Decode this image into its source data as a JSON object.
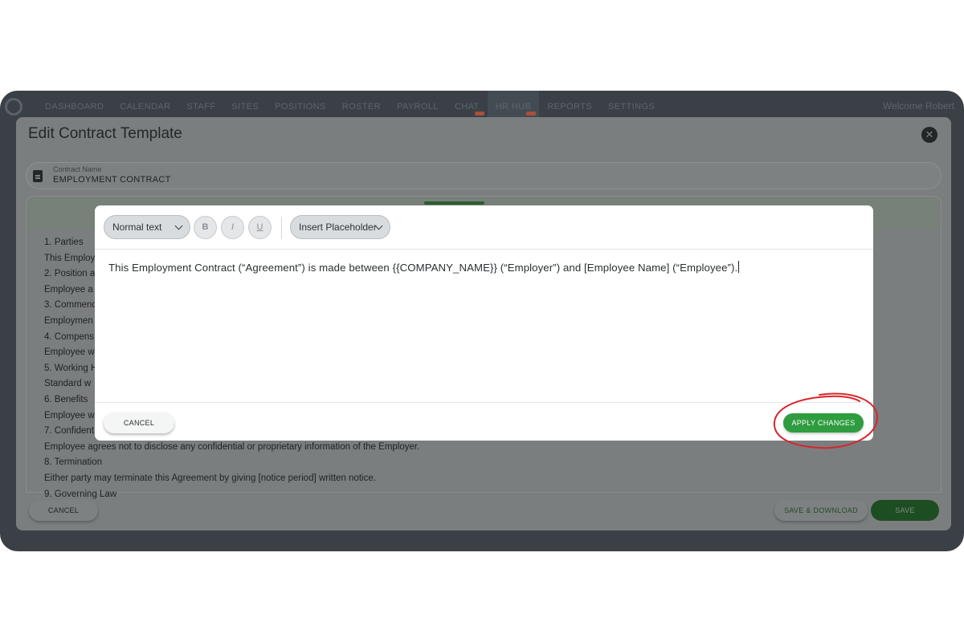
{
  "nav": {
    "items": [
      {
        "label": "DASHBOARD"
      },
      {
        "label": "CALENDAR"
      },
      {
        "label": "STAFF"
      },
      {
        "label": "SITES"
      },
      {
        "label": "POSITIONS"
      },
      {
        "label": "ROSTER"
      },
      {
        "label": "PAYROLL"
      },
      {
        "label": "CHAT"
      },
      {
        "label": "HR HUB"
      },
      {
        "label": "REPORTS"
      },
      {
        "label": "SETTINGS"
      }
    ],
    "welcome": "Welcome Robert"
  },
  "dialog": {
    "title": "Edit Contract Template",
    "contract_name_label": "Contract Name",
    "contract_name_value": "EMPLOYMENT CONTRACT",
    "background_lines": [
      "1. Parties",
      "This Employ",
      "2. Position a",
      "Employee a",
      "3. Commenc",
      "Employmen",
      "4. Compens",
      "Employee w",
      "5. Working H",
      "Standard w",
      "6. Benefits",
      "Employee w",
      "7. Confident",
      "Employee agrees not to disclose any confidential or proprietary information of the Employer.",
      "8. Termination",
      "Either party may terminate this Agreement by giving [notice period] written notice.",
      "9. Governing Law"
    ],
    "cancel_label": "CANCEL",
    "save_download_label": "SAVE & DOWNLOAD",
    "save_label": "SAVE"
  },
  "modal": {
    "text_style_selected": "Normal text",
    "bold_label": "B",
    "italic_label": "I",
    "underline_label": "U",
    "insert_placeholder_label": "Insert Placeholder",
    "content": "This Employment Contract (“Agreement”) is made between {{COMPANY_NAME}} (“Employer”) and [Employee Name] (“Employee”).",
    "cancel_label": "CANCEL",
    "apply_label": "APPLY CHANGES"
  },
  "colors": {
    "accent_green": "#2e9c3f",
    "annotation_red": "#d9252b"
  }
}
